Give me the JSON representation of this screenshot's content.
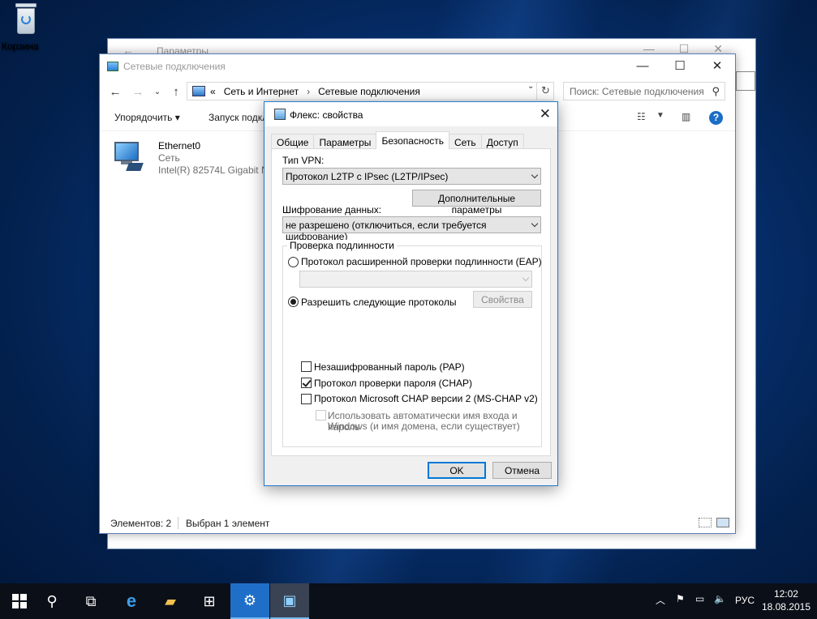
{
  "desktop": {
    "recycle_bin_label": "Корзина"
  },
  "settings_window": {
    "title": "Параметры"
  },
  "explorer": {
    "title": "Сетевые подключения",
    "breadcrumb": {
      "prefix": "«",
      "part1": "Сеть и Интернет",
      "part2": "Сетевые подключения"
    },
    "search_placeholder": "Поиск: Сетевые подключения",
    "commands": {
      "organize": "Упорядочить",
      "launch": "Запуск подкл"
    },
    "adapter": {
      "name": "Ethernet0",
      "network": "Сеть",
      "device": "Intel(R) 82574L Gigabit Ne"
    },
    "status": {
      "items": "Элементов: 2",
      "selected": "Выбран 1 элемент"
    }
  },
  "dialog": {
    "title": "Флекс: свойства",
    "tabs": [
      "Общие",
      "Параметры",
      "Безопасность",
      "Сеть",
      "Доступ"
    ],
    "active_tab": "Безопасность",
    "vpn_type_label": "Тип VPN:",
    "vpn_type_value": "Протокол L2TP с IPsec (L2TP/IPsec)",
    "advanced_button": "Дополнительные параметры",
    "encryption_label": "Шифрование данных:",
    "encryption_value": "не разрешено (отключиться, если требуется шифрование)",
    "auth_group_title": "Проверка подлинности",
    "eap_radio": "Протокол расширенной проверки подлинности (EAP)",
    "allow_radio": "Разрешить следующие протоколы",
    "properties_button": "Свойства",
    "pap_check": "Незашифрованный пароль (PAP)",
    "chap_check": "Протокол проверки пароля (CHAP)",
    "mschap_check": "Протокол Microsoft CHAP версии 2 (MS-CHAP v2)",
    "autologon_line1": "Использовать автоматически имя входа и пароль",
    "autologon_line2": "Windows (и имя домена, если существует)",
    "ok_button": "OK",
    "cancel_button": "Отмена"
  },
  "taskbar": {
    "language": "РУС",
    "time": "12:02",
    "date": "18.08.2015"
  }
}
